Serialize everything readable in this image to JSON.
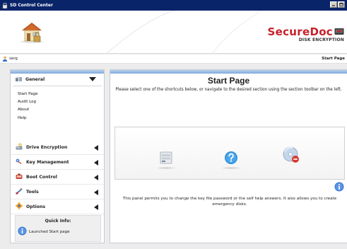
{
  "window": {
    "title": "SD Control Center"
  },
  "header": {
    "brand_name": "SecureDoc",
    "brand_subtitle": "DISK ENCRYPTION"
  },
  "userbar": {
    "user": "serg",
    "breadcrumb": "Start Page"
  },
  "sidebar": {
    "general": {
      "label": "General",
      "links": [
        "Start Page",
        "Audit Log",
        "About",
        "Help"
      ]
    },
    "sections": [
      {
        "label": "Drive Encryption",
        "icon": "drive-encryption-icon"
      },
      {
        "label": "Key Management",
        "icon": "key-management-icon"
      },
      {
        "label": "Boot Control",
        "icon": "boot-control-icon"
      },
      {
        "label": "Tools",
        "icon": "tools-icon"
      },
      {
        "label": "Options",
        "icon": "options-icon"
      }
    ],
    "quick_info": {
      "title": "Quick Info:",
      "message": "Launched Start page"
    }
  },
  "main": {
    "title": "Start Page",
    "intro": "Please select one of the shortcuts below, or navigate to the desired section using the section toolbar on the left.",
    "shortcuts": [
      "key-file-icon",
      "help-question-icon",
      "emergency-disk-icon"
    ],
    "description": "This panel permits you to change the key file password or the self help answers. It also allows you to create emergency disks."
  },
  "colors": {
    "brand_red": "#c8202a",
    "titlebar": "#0a246a",
    "accent_blue": "#7fa9d9"
  }
}
